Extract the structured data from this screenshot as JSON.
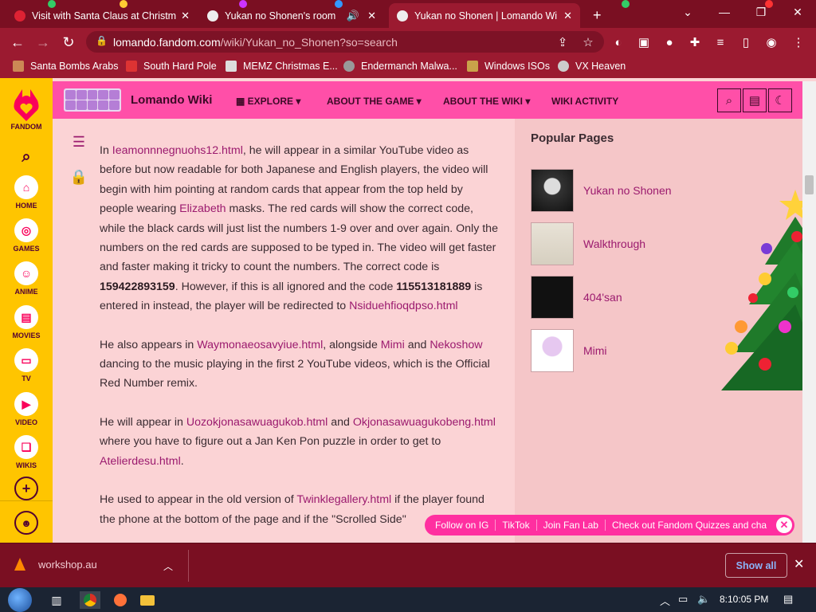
{
  "browser": {
    "tabs": [
      {
        "title": "Visit with Santa Claus at Christma",
        "active": false
      },
      {
        "title": "Yukan no Shonen's room",
        "active": false
      },
      {
        "title": "Yukan no Shonen | Lomando Wi",
        "active": true
      }
    ],
    "url_domain": "lomando.fandom.com",
    "url_path": "/wiki/Yukan_no_Shonen?so=search",
    "bookmarks": [
      "Santa Bombs Arabs",
      "South Hard Pole",
      "MEMZ Christmas E...",
      "Endermanch Malwa...",
      "Windows ISOs",
      "VX Heaven"
    ]
  },
  "global_nav": {
    "brand": "FANDOM",
    "items": [
      "HOME",
      "GAMES",
      "ANIME",
      "MOVIES",
      "TV",
      "VIDEO",
      "WIKIS"
    ]
  },
  "wiki_header": {
    "title": "Lomando Wiki",
    "nav": [
      "EXPLORE",
      "ABOUT THE GAME",
      "ABOUT THE WIKI",
      "WIKI ACTIVITY"
    ]
  },
  "article": {
    "p1": {
      "t1": "In ",
      "l1": "Ieamonnnegnuohs12.html",
      "t2": ", he will appear in a similar YouTube video as before but now readable for both Japanese and English players, the video will begin with him pointing at random cards that appear from the top held by people wearing ",
      "l2": "Elizabeth",
      "t3": " masks. The red cards will show the correct code, while the black cards will just list the numbers 1-9 over and over again. Only the numbers on the red cards are supposed to be typed in. The video will get faster and faster making it tricky to count the numbers. The correct code is ",
      "b1": "159422893159",
      "t4": ". However, if this is all ignored and the code ",
      "b2": "115513181889",
      "t5": " is entered in instead, the player will be redirected to ",
      "l3": "Nsiduehfioqdpso.html"
    },
    "p2": {
      "t1": "He also appears in ",
      "l1": "Waymonaeosavyiue.html",
      "t2": ", alongside ",
      "l2": "Mimi",
      "t3": " and ",
      "l3": "Nekoshow",
      "t4": " dancing to the music playing in the first 2 YouTube videos, which is the Official Red Number remix."
    },
    "p3": {
      "t1": "He will appear in ",
      "l1": "Uozokjonasawuagukob.html",
      "t2": " and ",
      "l2": "Okjonasawuagukobeng.html",
      "t3": " where you have to figure out a Jan Ken Pon puzzle in order to get to ",
      "l3": "Atelierdesu.html",
      "t4": "."
    },
    "p4": {
      "t1": "He used to appear in the old version of ",
      "l1": "Twinklegallery.html",
      "t2": " if the player found the phone at the bottom of the page and if the \"Scrolled Side\""
    }
  },
  "rail": {
    "title": "Popular Pages",
    "pages": [
      "Yukan no Shonen",
      "Walkthrough",
      "404'san",
      "Mimi"
    ]
  },
  "social_bar": [
    "Follow on IG",
    "TikTok",
    "Join Fan Lab",
    "Check out Fandom Quizzes and cha"
  ],
  "downloads": {
    "file": "workshop.au",
    "show_all": "Show all"
  },
  "taskbar": {
    "time": "8:10:05 PM"
  },
  "colors": {
    "chrome": "#9b1a30",
    "fandom_yellow": "#ffc500",
    "wiki_pink": "#ff4fa8",
    "link": "#9b1a6e"
  }
}
